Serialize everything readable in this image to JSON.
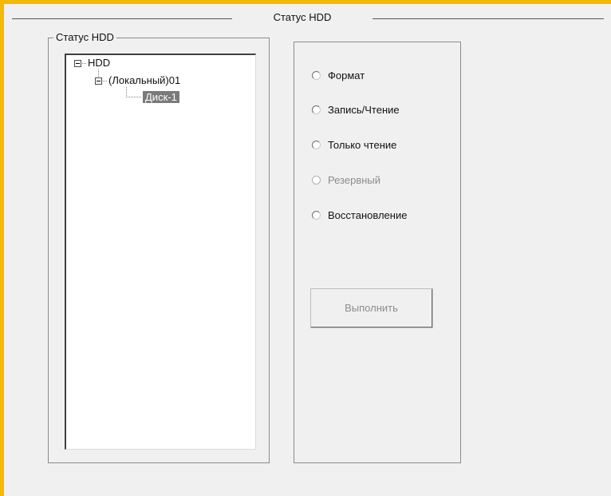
{
  "window": {
    "title": "Статус HDD"
  },
  "hdd_group": {
    "title": "Статус HDD",
    "tree": {
      "root": "HDD",
      "child": "(Локальный)01",
      "leaf": "Диск-1"
    }
  },
  "actions": {
    "options": [
      {
        "label": "Формат",
        "enabled": true,
        "selected": false
      },
      {
        "label": "Запись/Чтение",
        "enabled": true,
        "selected": false
      },
      {
        "label": "Только чтение",
        "enabled": true,
        "selected": false
      },
      {
        "label": "Резервный",
        "enabled": false,
        "selected": false
      },
      {
        "label": "Восстановление",
        "enabled": true,
        "selected": false
      }
    ],
    "execute_label": "Выполнить"
  },
  "colors": {
    "accent_border": "#f6b800",
    "dialog_background": "#f0f0f0",
    "selection_background": "#7a7a7a"
  }
}
